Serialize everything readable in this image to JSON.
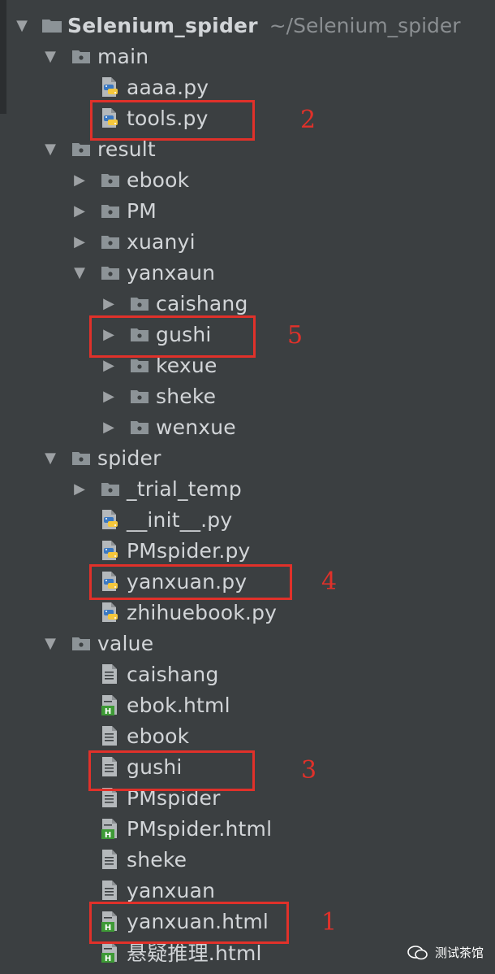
{
  "tree": {
    "root": {
      "name": "Selenium_spider",
      "path": "~/Selenium_spider"
    },
    "rows": [
      {
        "label": "main",
        "kind": "folder",
        "depth": 1,
        "expanded": true
      },
      {
        "label": "aaaa.py",
        "kind": "python",
        "depth": 2
      },
      {
        "label": "tools.py",
        "kind": "python",
        "depth": 2
      },
      {
        "label": "result",
        "kind": "folder",
        "depth": 1,
        "expanded": true
      },
      {
        "label": "ebook",
        "kind": "folder",
        "depth": 2,
        "expanded": false
      },
      {
        "label": "PM",
        "kind": "folder",
        "depth": 2,
        "expanded": false
      },
      {
        "label": "xuanyi",
        "kind": "folder",
        "depth": 2,
        "expanded": false
      },
      {
        "label": "yanxaun",
        "kind": "folder",
        "depth": 2,
        "expanded": true
      },
      {
        "label": "caishang",
        "kind": "folder",
        "depth": 3,
        "expanded": false
      },
      {
        "label": "gushi",
        "kind": "folder",
        "depth": 3,
        "expanded": false
      },
      {
        "label": "kexue",
        "kind": "folder",
        "depth": 3,
        "expanded": false
      },
      {
        "label": "sheke",
        "kind": "folder",
        "depth": 3,
        "expanded": false
      },
      {
        "label": "wenxue",
        "kind": "folder",
        "depth": 3,
        "expanded": false
      },
      {
        "label": "spider",
        "kind": "folder",
        "depth": 1,
        "expanded": true
      },
      {
        "label": "_trial_temp",
        "kind": "folder",
        "depth": 2,
        "expanded": false
      },
      {
        "label": "__init__.py",
        "kind": "python",
        "depth": 2
      },
      {
        "label": "PMspider.py",
        "kind": "python",
        "depth": 2
      },
      {
        "label": "yanxuan.py",
        "kind": "python",
        "depth": 2
      },
      {
        "label": "zhihuebook.py",
        "kind": "python",
        "depth": 2
      },
      {
        "label": "value",
        "kind": "folder",
        "depth": 1,
        "expanded": true
      },
      {
        "label": "caishang",
        "kind": "text",
        "depth": 2
      },
      {
        "label": "ebok.html",
        "kind": "html",
        "depth": 2
      },
      {
        "label": "ebook",
        "kind": "text",
        "depth": 2
      },
      {
        "label": "gushi",
        "kind": "text",
        "depth": 2
      },
      {
        "label": "PMspider",
        "kind": "text",
        "depth": 2
      },
      {
        "label": "PMspider.html",
        "kind": "html",
        "depth": 2
      },
      {
        "label": "sheke",
        "kind": "text",
        "depth": 2
      },
      {
        "label": "yanxuan",
        "kind": "text",
        "depth": 2
      },
      {
        "label": "yanxuan.html",
        "kind": "html",
        "depth": 2
      },
      {
        "label": "悬疑推理.html",
        "kind": "html",
        "depth": 2
      }
    ]
  },
  "annotations": [
    {
      "number": "2",
      "target": "tools.py"
    },
    {
      "number": "5",
      "target": "gushi"
    },
    {
      "number": "4",
      "target": "yanxuan.py"
    },
    {
      "number": "3",
      "target": "gushi"
    },
    {
      "number": "1",
      "target": "yanxuan.html"
    }
  ],
  "watermark": {
    "text": "测试茶馆"
  },
  "colors": {
    "background": "#3b3f41",
    "text": "#d2d5d8",
    "callout": "#e0312a",
    "folder_icon": "#8c9397",
    "python_blue": "#3a78c2",
    "python_yellow": "#f5c73c",
    "html_green": "#3e9a36"
  }
}
